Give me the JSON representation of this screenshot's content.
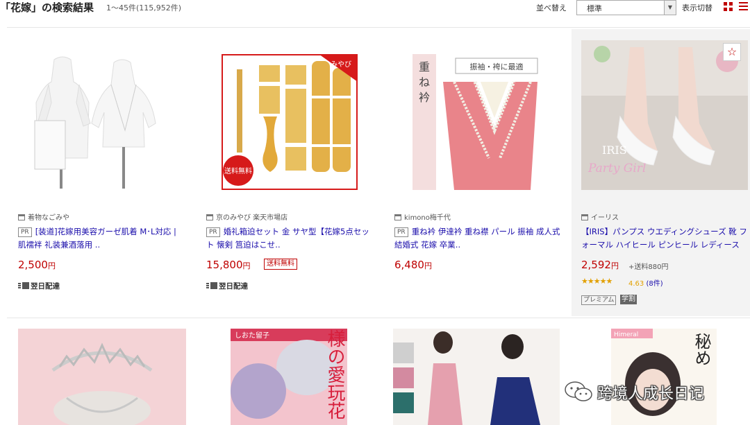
{
  "header": {
    "title": "「花嫁」の検索結果",
    "count": "1～45件(115,952件)",
    "sort_label": "並べ替え",
    "sort_value": "標準",
    "view_label": "表示切替"
  },
  "products": [
    {
      "shop": "着物なごみや",
      "pr": "PR",
      "name": "[装道]花嫁用美容ガーゼ肌着 M･L対応 | 肌襦袢 礼装兼酒落用 ..",
      "price": "2,500",
      "yen": "円",
      "delivery": "翌日配達"
    },
    {
      "shop": "京のみやび 楽天市場店",
      "pr": "PR",
      "name": "婚礼箱迫セット 金 サヤ型【花嫁5点セット 懐剣 筥迫はこせ..",
      "price": "15,800",
      "yen": "円",
      "shipping_free": "送料無料",
      "delivery": "翌日配達",
      "image_tag_top": "みやび",
      "image_tag_bottom": "送料無料"
    },
    {
      "shop": "kimono梅千代",
      "pr": "PR",
      "name": "重ね衿 伊達衿 重ね襟 パール 振袖 成人式 結婚式 花嫁 卒業..",
      "price": "6,480",
      "yen": "円",
      "image_vertical_text": "重ね衿",
      "image_banner": "振袖・袴に最適"
    },
    {
      "shop": "イーリス",
      "name": "【IRIS】パンプス ウエディングシューズ 靴 フォーマル ハイヒール ピンヒール レディース",
      "price": "2,592",
      "yen": "円",
      "shipping_fee": "+送料880円",
      "stars": "★★★★★",
      "rating": "4.63",
      "reviews": "(8件)",
      "badge_premium": "プレミアム",
      "badge_student": "学割",
      "image_brand": "IRIS",
      "image_script": "Party Girl",
      "fav_icon": "☆"
    }
  ],
  "second_row": {
    "manga1_author": "しおた留子",
    "manga1_title": "公爵様の愛玩花",
    "manga2_title": "秘め",
    "manga2_label": "Himeral"
  },
  "watermark": "跨境人成长日记",
  "colors": {
    "accent": "#bf0000",
    "link": "#1a0dab",
    "star": "#e2a000"
  }
}
